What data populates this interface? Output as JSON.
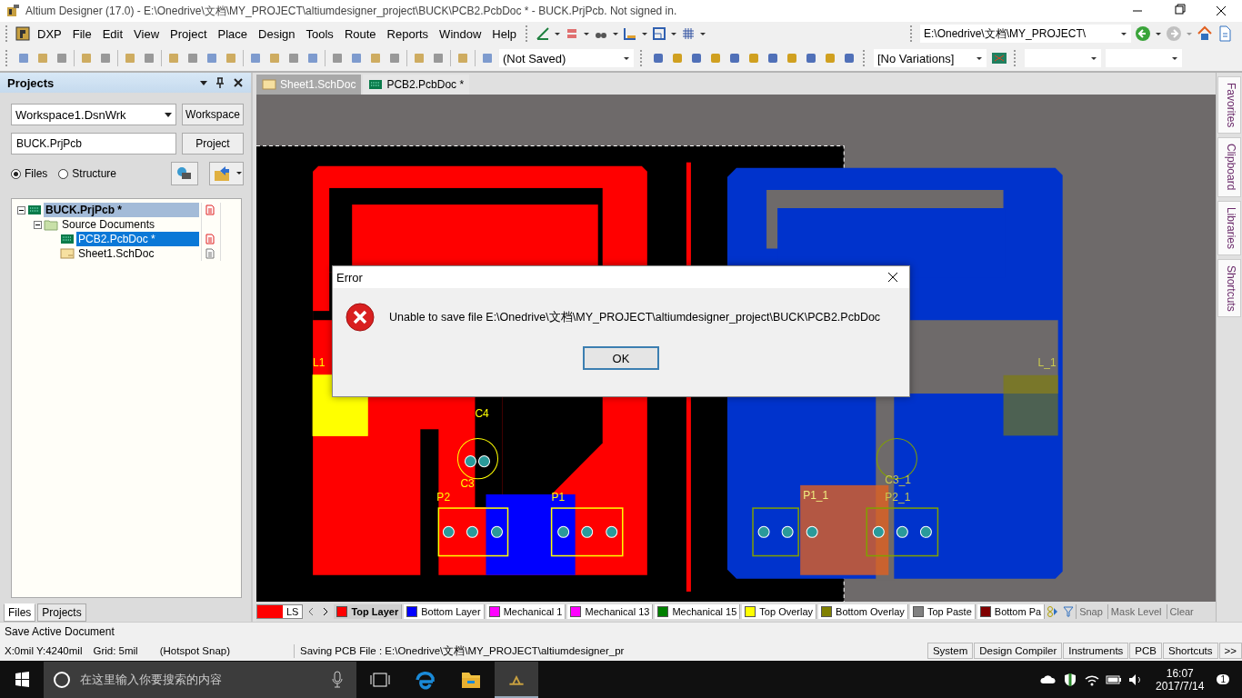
{
  "window": {
    "title": "Altium Designer (17.0) - E:\\Onedrive\\文档\\MY_PROJECT\\altiumdesigner_project\\BUCK\\PCB2.PcbDoc * - BUCK.PrjPcb. Not signed in."
  },
  "menu": [
    "DXP",
    "File",
    "Edit",
    "View",
    "Project",
    "Place",
    "Design",
    "Tools",
    "Route",
    "Reports",
    "Window",
    "Help"
  ],
  "toolbar": {
    "path_combo": "E:\\Onedrive\\文档\\MY_PROJECT\\",
    "save_state_combo": "(Not Saved)",
    "variations_combo": "[No Variations]"
  },
  "projects_panel": {
    "title": "Projects",
    "workspace_combo": "Workspace1.DsnWrk",
    "workspace_button": "Workspace",
    "project_field": "BUCK.PrjPcb",
    "project_button": "Project",
    "radios": [
      {
        "label": "Files",
        "selected": true
      },
      {
        "label": "Structure",
        "selected": false
      }
    ],
    "tree": [
      {
        "label": "BUCK.PrjPcb *",
        "kind": "project",
        "active": true,
        "selected": false,
        "expanded": true,
        "children": [
          {
            "label": "Source Documents",
            "kind": "folder",
            "active": false,
            "selected": false,
            "expanded": true,
            "children": [
              {
                "label": "PCB2.PcbDoc *",
                "kind": "pcb",
                "active": false,
                "selected": true
              },
              {
                "label": "Sheet1.SchDoc",
                "kind": "schematic",
                "active": false,
                "selected": false
              }
            ]
          }
        ]
      }
    ],
    "tabs": [
      {
        "label": "Files",
        "selected": true
      },
      {
        "label": "Projects",
        "selected": false
      }
    ]
  },
  "doc_tabs": [
    {
      "label": "Sheet1.SchDoc",
      "kind": "schematic",
      "selected": false
    },
    {
      "label": "PCB2.PcbDoc *",
      "kind": "pcb",
      "selected": true
    }
  ],
  "pcb_labels": [
    {
      "text": "L1",
      "color": "#ffff00"
    },
    {
      "text": "C4",
      "color": "#ffff00"
    },
    {
      "text": "C3",
      "color": "#ffff00"
    },
    {
      "text": "P2",
      "color": "#ffff00"
    },
    {
      "text": "P1",
      "color": "#ffff00"
    },
    {
      "text": "P1_1",
      "color": "#f0f080"
    },
    {
      "text": "P2_1",
      "color": "#c8c850"
    },
    {
      "text": "C3_1",
      "color": "#c8c850"
    },
    {
      "text": "L_1",
      "color": "#c8c850"
    }
  ],
  "current_layer": {
    "label": "LS",
    "color": "#ff0000"
  },
  "layer_tabs": [
    {
      "label": "Top Layer",
      "color": "#ff0000",
      "selected": true
    },
    {
      "label": "Bottom Layer",
      "color": "#0000ff",
      "selected": false
    },
    {
      "label": "Mechanical 1",
      "color": "#ff00ff",
      "selected": false
    },
    {
      "label": "Mechanical 13",
      "color": "#ff00ff",
      "selected": false
    },
    {
      "label": "Mechanical 15",
      "color": "#008000",
      "selected": false
    },
    {
      "label": "Top Overlay",
      "color": "#ffff00",
      "selected": false
    },
    {
      "label": "Bottom Overlay",
      "color": "#808000",
      "selected": false
    },
    {
      "label": "Top Paste",
      "color": "#808080",
      "selected": false
    },
    {
      "label": "Bottom Pa",
      "color": "#800000",
      "selected": false
    }
  ],
  "layer_buttons": [
    "Snap",
    "Mask Level",
    "Clear"
  ],
  "side_tabs": [
    "Favorites",
    "Clipboard",
    "Libraries",
    "Shortcuts"
  ],
  "dialog": {
    "title": "Error",
    "message": "Unable to save file E:\\Onedrive\\文档\\MY_PROJECT\\altiumdesigner_project\\BUCK\\PCB2.PcbDoc",
    "button": "OK"
  },
  "status_bar": {
    "message": "Save Active Document",
    "coords": "X:0mil Y:4240mil",
    "grid": "Grid: 5mil",
    "snap": "(Hotspot Snap)",
    "progress": "Saving PCB File : E:\\Onedrive\\文档\\MY_PROJECT\\altiumdesigner_pr",
    "panel_buttons": [
      "System",
      "Design Compiler",
      "Instruments",
      "PCB",
      "Shortcuts",
      ">>"
    ]
  },
  "taskbar": {
    "search_placeholder": "在这里输入你要搜索的内容",
    "time": "16:07",
    "date": "2017/7/14",
    "notification_count": "1"
  }
}
